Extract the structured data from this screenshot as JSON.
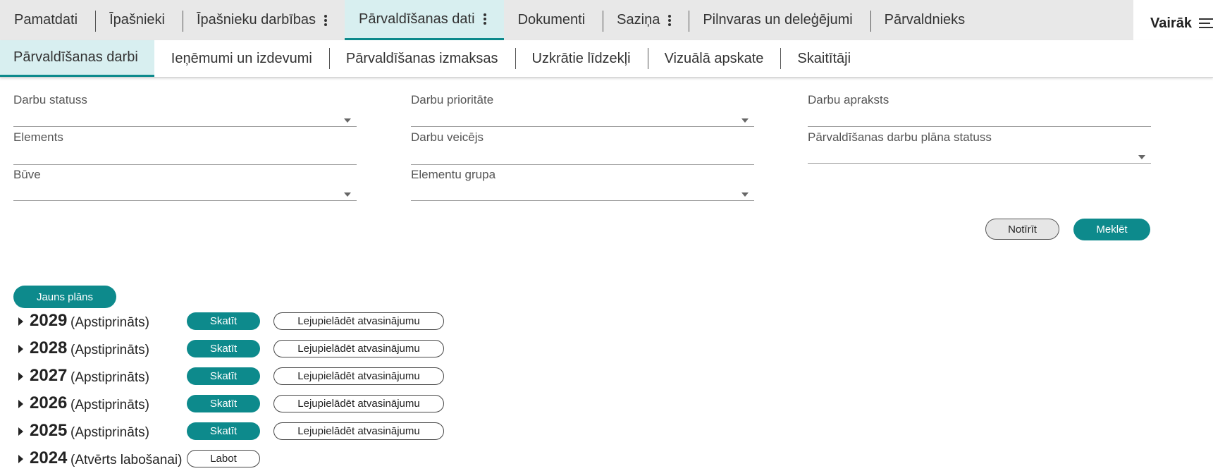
{
  "top_tabs": [
    {
      "label": "Pamatdati"
    },
    {
      "label": "Īpašnieki"
    },
    {
      "label": "Īpašnieku darbības"
    },
    {
      "label": "Pārvaldīšanas dati",
      "active": true
    },
    {
      "label": "Dokumenti"
    },
    {
      "label": "Saziņa"
    },
    {
      "label": "Pilnvaras un deleģējumi"
    },
    {
      "label": "Pārvaldnieks"
    }
  ],
  "more_label": "Vairāk",
  "sub_tabs": [
    {
      "label": "Pārvaldīšanas darbi",
      "active": true
    },
    {
      "label": "Ieņēmumi un izdevumi"
    },
    {
      "label": "Pārvaldīšanas izmaksas"
    },
    {
      "label": "Uzkrātie līdzekļi"
    },
    {
      "label": "Vizuālā apskate"
    },
    {
      "label": "Skaitītāji"
    }
  ],
  "filters": {
    "work_status": "Darbu statuss",
    "work_priority": "Darbu prioritāte",
    "work_description": "Darbu apraksts",
    "element": "Elements",
    "work_performer": "Darbu veicējs",
    "plan_status": "Pārvaldīšanas darbu plāna statuss",
    "building": "Būve",
    "element_group": "Elementu grupa"
  },
  "buttons": {
    "clear": "Notīrīt",
    "search": "Meklēt",
    "new_plan": "Jauns plāns"
  },
  "plans": [
    {
      "year": "2029",
      "status": "(Apstiprināts)",
      "view": "Skatīt",
      "download": "Lejupielādēt atvasinājumu"
    },
    {
      "year": "2028",
      "status": "(Apstiprināts)",
      "view": "Skatīt",
      "download": "Lejupielādēt atvasinājumu"
    },
    {
      "year": "2027",
      "status": "(Apstiprināts)",
      "view": "Skatīt",
      "download": "Lejupielādēt atvasinājumu"
    },
    {
      "year": "2026",
      "status": "(Apstiprināts)",
      "view": "Skatīt",
      "download": "Lejupielādēt atvasinājumu"
    },
    {
      "year": "2025",
      "status": "(Apstiprināts)",
      "view": "Skatīt",
      "download": "Lejupielādēt atvasinājumu"
    },
    {
      "year": "2024",
      "status": "(Atvērts labošanai)",
      "edit": "Labot"
    }
  ],
  "colors": {
    "accent": "#0d8a8c",
    "active_tab_bg": "#d8eff0"
  }
}
